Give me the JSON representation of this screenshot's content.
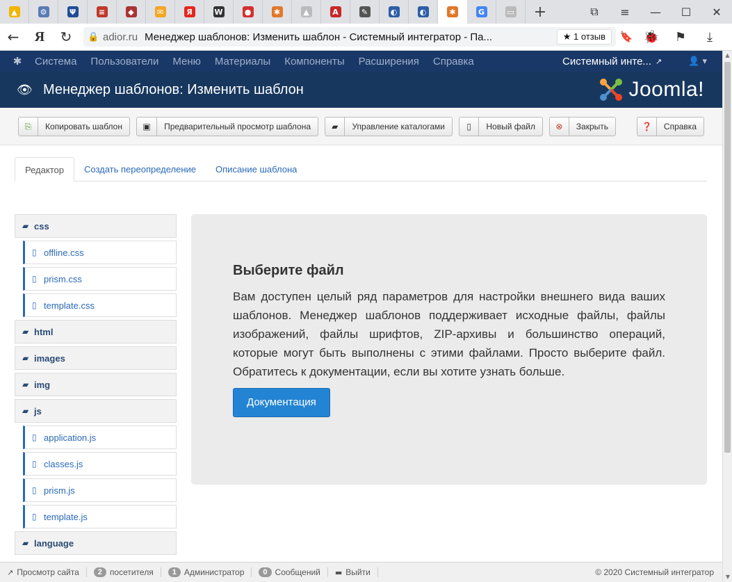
{
  "browser": {
    "tabs": [
      {
        "icon": "google-drive-icon",
        "color": "#f4b400",
        "glyph": "▲"
      },
      {
        "icon": "portal-icon",
        "color": "#5a7bb5",
        "glyph": "⚙"
      },
      {
        "icon": "psi-icon",
        "color": "#1f4b99",
        "glyph": "Ψ"
      },
      {
        "icon": "site-icon",
        "color": "#c0392b",
        "glyph": "≡"
      },
      {
        "icon": "site-icon",
        "color": "#a33",
        "glyph": "◆"
      },
      {
        "icon": "mail-icon",
        "color": "#f5a623",
        "glyph": "✉"
      },
      {
        "icon": "yandex-icon",
        "color": "#e52620",
        "glyph": "Я"
      },
      {
        "icon": "wikipedia-icon",
        "color": "#333",
        "glyph": "W"
      },
      {
        "icon": "opera-icon",
        "color": "#d32f2f",
        "glyph": "●"
      },
      {
        "icon": "joomla-icon",
        "color": "#e1782a",
        "glyph": "✱"
      },
      {
        "icon": "triangle-icon",
        "color": "#bbb",
        "glyph": "▲"
      },
      {
        "icon": "site-icon",
        "color": "#c62828",
        "glyph": "A"
      },
      {
        "icon": "gimp-icon",
        "color": "#555",
        "glyph": "✎"
      },
      {
        "icon": "site-icon",
        "color": "#2c5ea8",
        "glyph": "◐"
      },
      {
        "icon": "site-icon",
        "color": "#2c5ea8",
        "glyph": "◐"
      },
      {
        "icon": "joomla-icon",
        "color": "#e1782a",
        "glyph": "✱",
        "active": true
      },
      {
        "icon": "google-icon",
        "color": "#4285f4",
        "glyph": "G"
      },
      {
        "icon": "blank-page-icon",
        "color": "#bbb",
        "glyph": "▭"
      }
    ],
    "domain": "adior.ru",
    "page_title": "Менеджер шаблонов: Изменить шаблон - Системный интегратор - Па...",
    "reviews": "★ 1 отзыв",
    "yandex_button": "Я"
  },
  "topmenu": {
    "items": [
      "Система",
      "Пользователи",
      "Меню",
      "Материалы",
      "Компоненты",
      "Расширения",
      "Справка"
    ],
    "site_link": "Системный инте..."
  },
  "header": {
    "title": "Менеджер шаблонов: Изменить шаблон",
    "brand": "Joomla!"
  },
  "toolbar": {
    "copy": "Копировать шаблон",
    "preview": "Предварительный просмотр шаблона",
    "folders": "Управление каталогами",
    "new_file": "Новый файл",
    "close": "Закрыть",
    "help": "Справка"
  },
  "tabs": [
    "Редактор",
    "Создать переопределение",
    "Описание шаблона"
  ],
  "tree": [
    {
      "type": "folder",
      "label": "css"
    },
    {
      "type": "file",
      "label": "offline.css"
    },
    {
      "type": "file",
      "label": "prism.css"
    },
    {
      "type": "file",
      "label": "template.css"
    },
    {
      "type": "folder",
      "label": "html"
    },
    {
      "type": "folder",
      "label": "images"
    },
    {
      "type": "folder",
      "label": "img"
    },
    {
      "type": "folder",
      "label": "js"
    },
    {
      "type": "file",
      "label": "application.js"
    },
    {
      "type": "file",
      "label": "classes.js"
    },
    {
      "type": "file",
      "label": "prism.js"
    },
    {
      "type": "file",
      "label": "template.js"
    },
    {
      "type": "folder",
      "label": "language"
    }
  ],
  "panel": {
    "title": "Выберите файл",
    "text": "Вам доступен целый ряд параметров для настройки внешнего вида ваших шаблонов. Менеджер шаблонов поддерживает исходные файлы, файлы изображений, файлы шрифтов, ZIP-архивы и большинство операций, которые могут быть выполнены с этими файлами. Просто выберите файл. Обратитесь к документации, если вы хотите узнать больше.",
    "button": "Документация"
  },
  "statusbar": {
    "view_site": "Просмотр сайта",
    "visitors_count": "2",
    "visitors_label": "посетителя",
    "admins_count": "1",
    "admins_label": "Администратор",
    "messages_count": "0",
    "messages_label": "Сообщений",
    "logout": "Выйти",
    "copyright": "© 2020 Системный интегратор"
  },
  "colors": {
    "topmenu_bg": "#1a3867",
    "header_bg": "#17375e",
    "primary_button": "#2384d3",
    "link": "#2a69b8"
  }
}
